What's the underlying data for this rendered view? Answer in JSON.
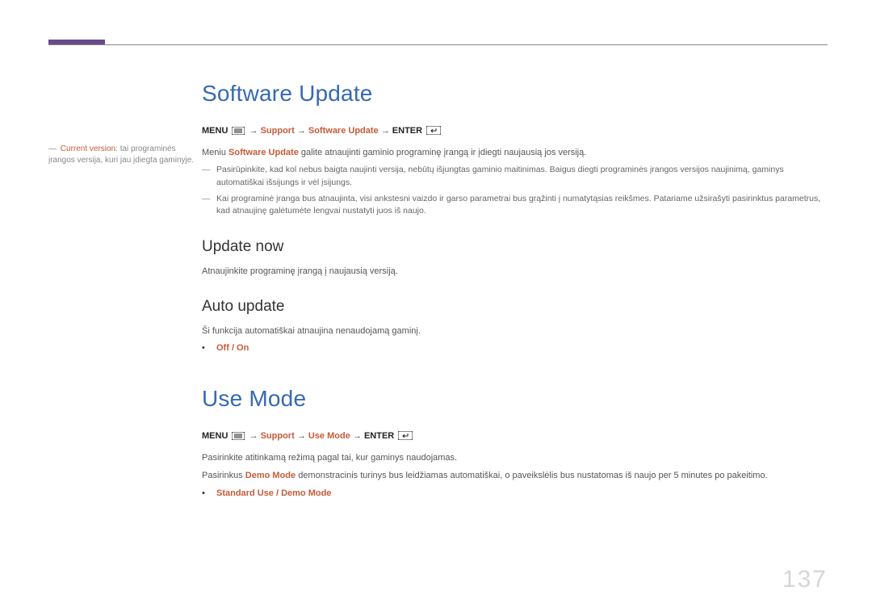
{
  "page_number": "137",
  "sidebar": {
    "note_dash": "―",
    "current_version_label": "Current version",
    "current_version_desc": ": tai programinės įrangos versija, kuri jau įdiegta gaminyje."
  },
  "headings": {
    "software_update": "Software Update",
    "update_now": "Update now",
    "auto_update": "Auto update",
    "use_mode": "Use Mode"
  },
  "menupath1": {
    "menu": "MENU",
    "arrow": " → ",
    "support": "Support",
    "software_update": "Software Update",
    "enter": "ENTER"
  },
  "menupath2": {
    "menu": "MENU",
    "arrow": " → ",
    "support": "Support",
    "use_mode": "Use Mode",
    "enter": "ENTER"
  },
  "software_update_body": {
    "prefix": "Meniu ",
    "strong": "Software Update",
    "suffix": " galite atnaujinti gaminio programinę įrangą ir įdiegti naujausią jos versiją."
  },
  "software_update_notes": [
    "Pasirūpinkite, kad kol nebus baigta naujinti versija, nebūtų išjungtas gaminio maitinimas. Baigus diegti programinės įrangos versijos naujinimą, gaminys automatiškai išsijungs ir vėl įsijungs.",
    "Kai programinė įranga bus atnaujinta, visi ankstesni vaizdo ir garso parametrai bus grąžinti į numatytąsias reikšmes. Patariame užsirašyti pasirinktus parametrus, kad atnaujinę galėtumėte lengvai nustatyti juos iš naujo."
  ],
  "note_dash": "―",
  "update_now_body": "Atnaujinkite programinę įrangą į naujausią versiją.",
  "auto_update_body": "Ši funkcija automatiškai atnaujina nenaudojamą gaminį.",
  "auto_update_option": "Off / On",
  "use_mode_body1": "Pasirinkite atitinkamą režimą pagal tai, kur gaminys naudojamas.",
  "use_mode_body2": {
    "prefix": "Pasirinkus ",
    "strong": "Demo Mode",
    "suffix": " demonstracinis turinys bus leidžiamas automatiškai, o paveikslėlis bus nustatomas iš naujo per 5 minutes po pakeitimo."
  },
  "use_mode_option": "Standard Use / Demo Mode",
  "bullet_dot": "•"
}
